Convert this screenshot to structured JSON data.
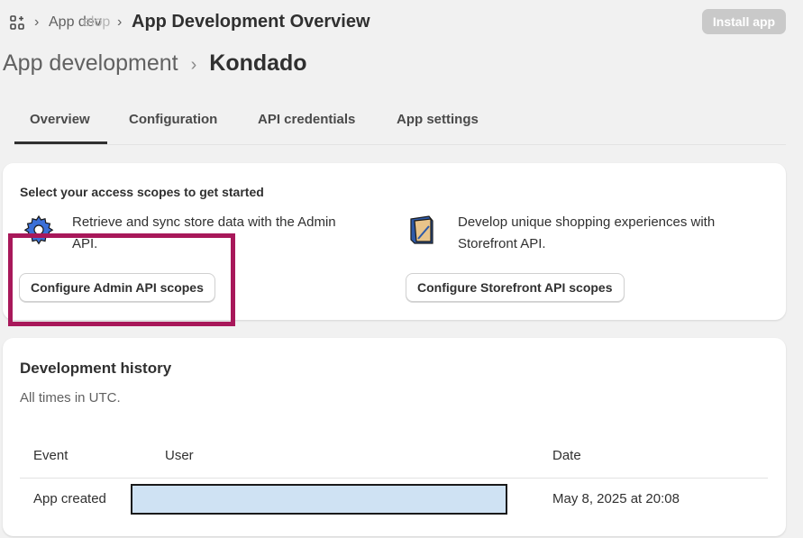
{
  "topbar": {
    "breadcrumb_app": "App dev",
    "breadcrumb_fade": "elopment",
    "separator": "›",
    "title": "App Development Overview",
    "install_label": "Install app"
  },
  "heading": {
    "parent": "App development",
    "separator": "›",
    "app_name": "Kondado"
  },
  "tabs": [
    {
      "label": "Overview",
      "active": true
    },
    {
      "label": "Configuration"
    },
    {
      "label": "API credentials"
    },
    {
      "label": "App settings"
    }
  ],
  "scopes": {
    "title": "Select your access scopes to get started",
    "admin": {
      "line1": "Retrieve and sync store data with the Admin",
      "line2": "API.",
      "button": "Configure Admin API scopes"
    },
    "storefront": {
      "line1": "Develop unique shopping experiences with",
      "line2": "Storefront API.",
      "button": "Configure Storefront API scopes"
    }
  },
  "history": {
    "title": "Development history",
    "subtitle": "All times in UTC.",
    "columns": [
      "Event",
      "User",
      "Date"
    ],
    "rows": [
      {
        "event": "App created",
        "user": "",
        "date": "May 8, 2025 at 20:08"
      }
    ]
  },
  "colors": {
    "highlight": "#a8185a",
    "redaction_fill": "#cfe2f3"
  }
}
